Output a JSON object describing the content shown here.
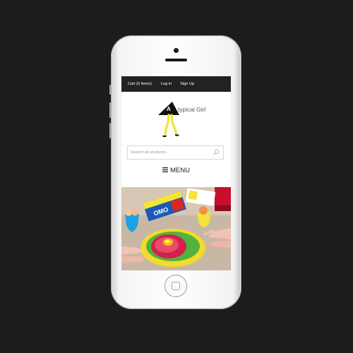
{
  "topbar": {
    "cart": "Cart (0 items)",
    "login": "Log in",
    "signup": "Sign Up"
  },
  "logo": {
    "letter": "A",
    "name": "typical Girl"
  },
  "search": {
    "placeholder": "Search all products..."
  },
  "menu": {
    "label": "MENU"
  },
  "hero": {
    "product_label": "OMO"
  },
  "colors": {
    "page_background": "#1c1c1c",
    "topbar": "#222222",
    "accent_yellow": "#f3e43a"
  },
  "icons": [
    "search-icon",
    "hamburger-icon",
    "home-button-icon"
  ]
}
